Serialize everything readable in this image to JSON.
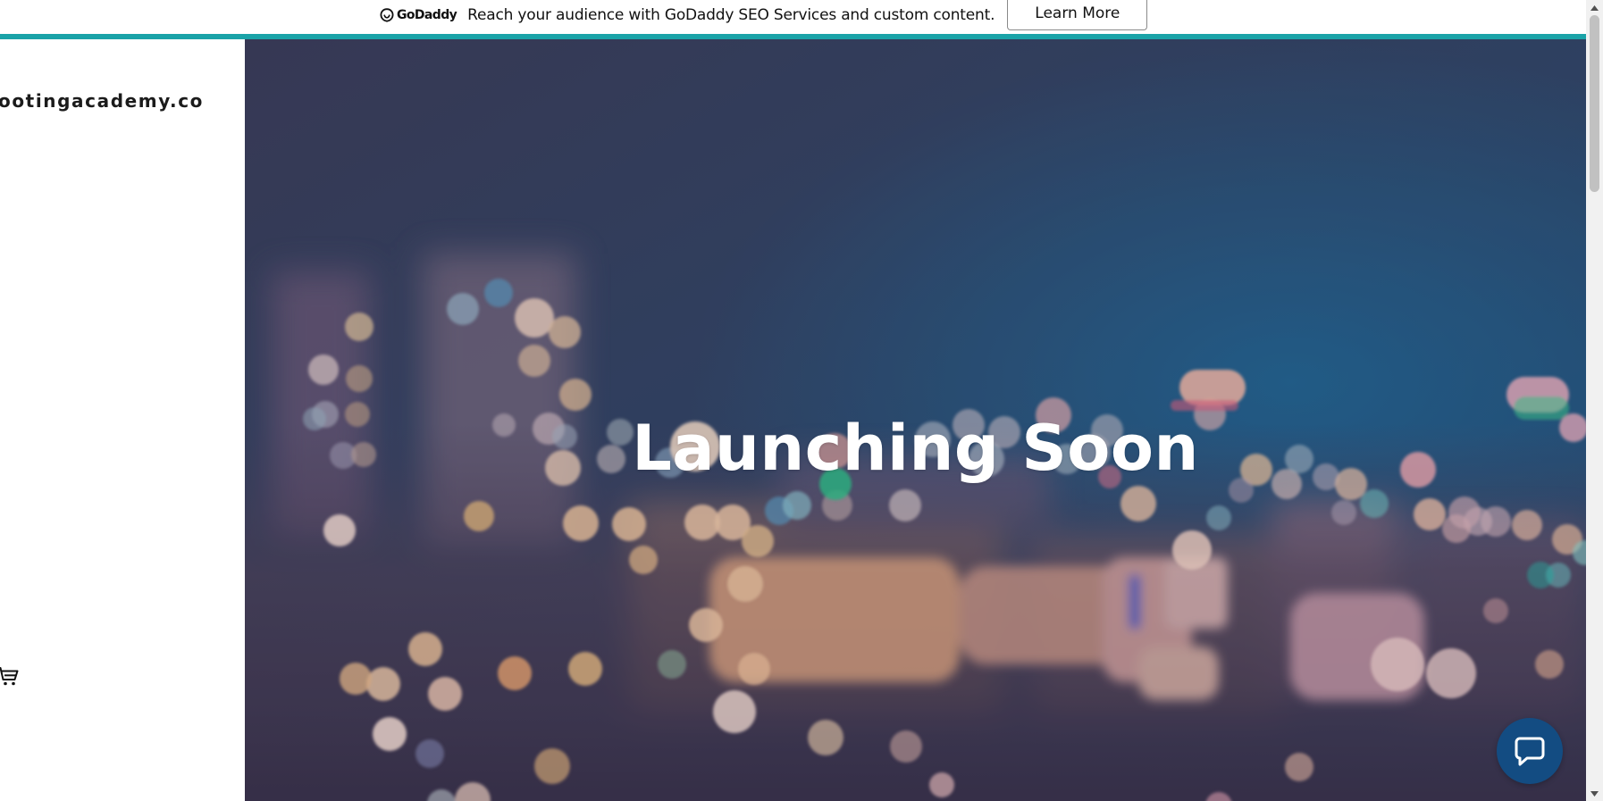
{
  "promo": {
    "brand": "GoDaddy",
    "message": "Reach your audience with GoDaddy SEO Services and custom content.",
    "cta_label": "Learn More",
    "accent_color": "#1aa3a8"
  },
  "sidebar": {
    "site_title": "ootingacademy.co",
    "cart_icon": "cart-icon"
  },
  "hero": {
    "title": "Launching Soon",
    "background": "blurred-city-lights-bokeh"
  },
  "chat": {
    "icon": "chat-bubble-icon",
    "color": "#134c82"
  }
}
